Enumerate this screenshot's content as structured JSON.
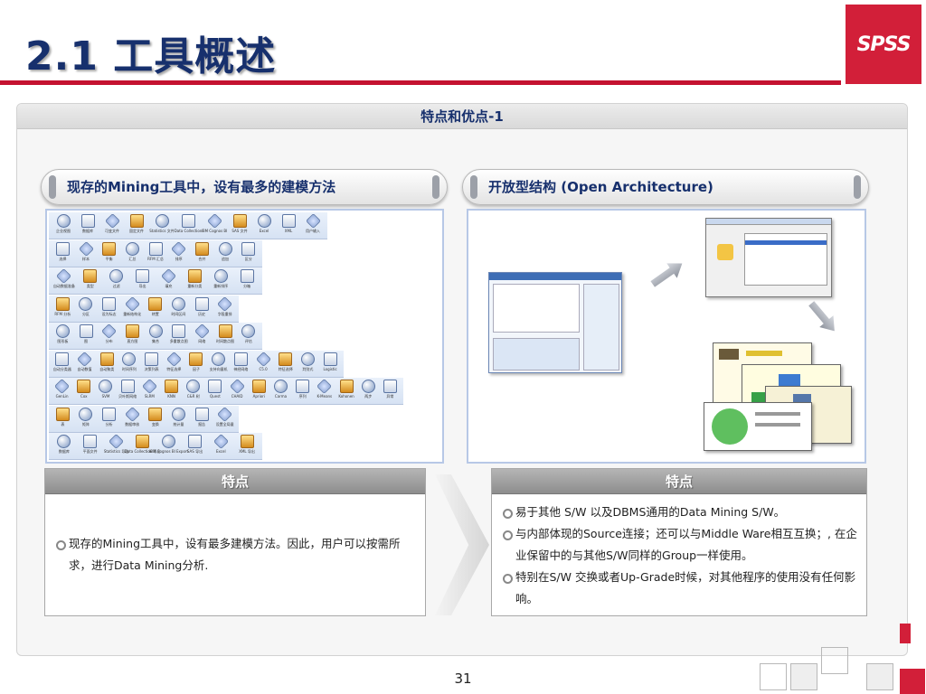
{
  "slide": {
    "title": "2.1 工具概述",
    "logo_text": "SPSS",
    "page_number": "31"
  },
  "panel": {
    "header": "特点和优点-1",
    "left_pill": "现存的Mining工具中，设有最多的建模方法",
    "right_pill": "开放型结构 (Open Architecture)"
  },
  "features_left": {
    "header": "特点",
    "bullets": [
      "现存的Mining工具中，设有最多建模方法。因此，用户可以按需所求，进行Data Mining分析."
    ]
  },
  "features_right": {
    "header": "特点",
    "bullets": [
      "易于其他 S/W 以及DBMS通用的Data Mining S/W。",
      "与内部体现的Source连接；还可以与Middle Ware相互互换；, 在企业保留中的与其他S/W同样的Group一样使用。",
      "特别在S/W 交换或者Up-Grade时候，对其他程序的使用没有任何影响。"
    ]
  },
  "palette": {
    "rows": [
      [
        "企业视图",
        "数据库",
        "可变文件",
        "固定文件",
        "Statistics 文件",
        "Data Collection",
        "IBM Cognos BI",
        "SAS 文件",
        "Excel",
        "XML",
        "用户输入"
      ],
      [
        "选择",
        "样本",
        "平衡",
        "汇总",
        "RFM 汇总",
        "排序",
        "合并",
        "追加",
        "区分"
      ],
      [
        "自动数据准备",
        "类型",
        "过滤",
        "导出",
        "填充",
        "重新分类",
        "重新排序",
        "分箱"
      ],
      [
        "RFM 分析",
        "分区",
        "设为标志",
        "重新结构化",
        "转置",
        "时间区间",
        "历史",
        "字段重排"
      ],
      [
        "图形板",
        "图",
        "分布",
        "直方图",
        "集合",
        "多重散点图",
        "网络",
        "时间散点图",
        "评估"
      ],
      [
        "自动分类器",
        "自动数值",
        "自动聚类",
        "时间序列",
        "决策列表",
        "特征选择",
        "因子",
        "支持向量机",
        "神经网络",
        "C5.0",
        "特征选择",
        "判别式",
        "Logistic"
      ],
      [
        "GenLin",
        "Cox",
        "SVM",
        "贝叶斯网络",
        "SLRM",
        "KNN",
        "C&R 树",
        "Quest",
        "CHAID",
        "Apriori",
        "Carma",
        "序列",
        "K-Means",
        "Kohonen",
        "两步",
        "异常"
      ],
      [
        "表",
        "矩阵",
        "分析",
        "数据审核",
        "变换",
        "统计量",
        "报告",
        "设置全局量"
      ],
      [
        "数据库",
        "平面文件",
        "Statistics 导出",
        "Data Collection 导出",
        "IBM Cognos BI Export",
        "SAS 导出",
        "Excel",
        "XML 导出"
      ]
    ]
  },
  "colors": {
    "title": "#17306d",
    "accent_red": "#d21f39",
    "rule_red": "#c41230"
  }
}
